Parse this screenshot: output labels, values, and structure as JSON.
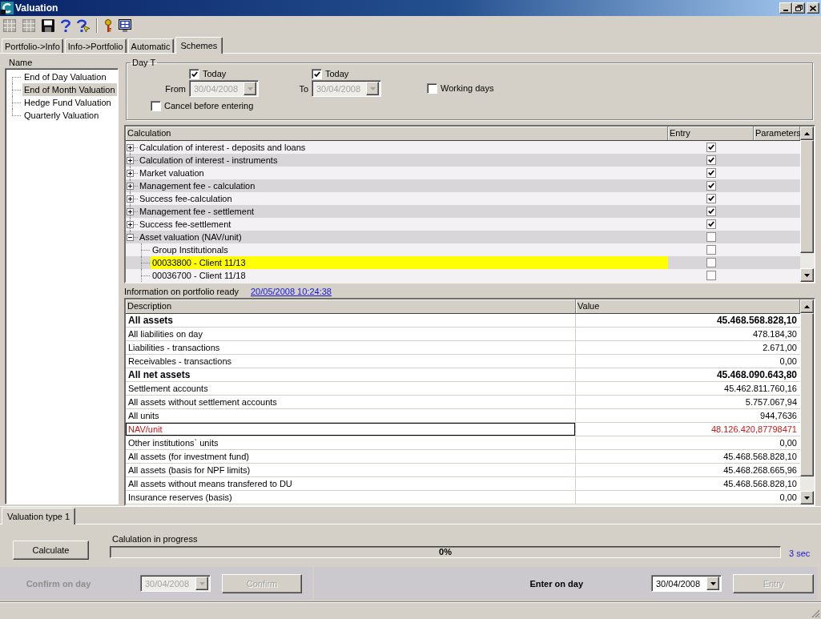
{
  "window": {
    "title": "Valuation"
  },
  "toolbar": [
    {
      "kind": "grid",
      "disabled": true
    },
    {
      "kind": "grid",
      "disabled": true
    },
    {
      "kind": "save",
      "disabled": false
    },
    {
      "kind": "help",
      "disabled": false
    },
    {
      "kind": "help-arrow",
      "disabled": false
    },
    {
      "kind": "separator"
    },
    {
      "kind": "key",
      "disabled": false
    },
    {
      "kind": "monitor",
      "disabled": false
    }
  ],
  "tabs": [
    {
      "label": "Portfolio->Info",
      "selected": false
    },
    {
      "label": "Info->Portfolio",
      "selected": false
    },
    {
      "label": "Automatic",
      "selected": false
    },
    {
      "label": "Schemes",
      "selected": true
    }
  ],
  "schemes": {
    "heading": "Name",
    "items": [
      {
        "label": "End of Day Valuation",
        "selected": false
      },
      {
        "label": "End of Month Valuation",
        "selected": true
      },
      {
        "label": "Hedge Fund Valuation",
        "selected": false
      },
      {
        "label": "Quarterly Valuation",
        "selected": false
      }
    ]
  },
  "day_t": {
    "title": "Day T",
    "from": {
      "today": {
        "label": "Today",
        "checked": true
      },
      "label": "From",
      "date": "30/04/2008",
      "disabled": true
    },
    "to": {
      "today": {
        "label": "Today",
        "checked": true
      },
      "label": "To",
      "date": "30/04/2008",
      "disabled": true
    },
    "working_days": {
      "label": "Working days",
      "checked": false
    },
    "cancel_before_entering": {
      "label": "Cancel before entering",
      "checked": false
    }
  },
  "calculation": {
    "columns": [
      "Calculation",
      "Entry",
      "Parameters"
    ],
    "rows": [
      {
        "label": "Calculation of interest - deposits and loans",
        "expanded": false,
        "entry": true,
        "selected": false
      },
      {
        "label": "Calculation of interest - instruments",
        "expanded": false,
        "entry": true,
        "selected": false
      },
      {
        "label": "Market valuation",
        "expanded": false,
        "entry": true,
        "selected": false
      },
      {
        "label": "Management fee - calculation",
        "expanded": false,
        "entry": true,
        "selected": false
      },
      {
        "label": "Success fee-calculation",
        "expanded": false,
        "entry": true,
        "selected": false
      },
      {
        "label": "Management fee - settlement",
        "expanded": false,
        "entry": true,
        "selected": false
      },
      {
        "label": "Success fee-settlement",
        "expanded": false,
        "entry": true,
        "selected": false
      },
      {
        "label": "Asset valuation (NAV/unit)",
        "expanded": true,
        "entry": false,
        "selected": false,
        "children": [
          {
            "label": "Group Institutionals",
            "entry": false,
            "selected": false
          },
          {
            "label": "00033800 - Client 11/13",
            "entry": false,
            "selected": true
          },
          {
            "label": "00036700 - Client 11/18",
            "entry": false,
            "selected": false
          }
        ]
      }
    ]
  },
  "info": {
    "label": "Information on portfolio ready",
    "timestamp": "20/05/2008 10:24:38"
  },
  "values": {
    "columns": [
      "Description",
      "Value"
    ],
    "rows": [
      {
        "description": "All assets",
        "value": "45.468.568.828,10",
        "kind": "total",
        "selected": false
      },
      {
        "description": "All liabilities on day",
        "value": "478.184,30",
        "kind": "plain",
        "selected": false
      },
      {
        "description": "Liabilities - transactions",
        "value": "2.671,00",
        "kind": "plain",
        "selected": false
      },
      {
        "description": "Receivables - transactions",
        "value": "0,00",
        "kind": "plain",
        "selected": false
      },
      {
        "description": "All net assets",
        "value": "45.468.090.643,80",
        "kind": "total",
        "selected": false
      },
      {
        "description": "Settlement accounts",
        "value": "45.462.811.760,16",
        "kind": "plain",
        "selected": false
      },
      {
        "description": "All assets without settlement accounts",
        "value": "5.757.067,94",
        "kind": "plain",
        "selected": false
      },
      {
        "description": "All units",
        "value": "944,7636",
        "kind": "plain",
        "selected": false
      },
      {
        "description": "NAV/unit",
        "value": "48.126.420,87798471",
        "kind": "alert",
        "selected": true
      },
      {
        "description": "Other institutions` units",
        "value": "0,00",
        "kind": "plain",
        "selected": false
      },
      {
        "description": "All assets (for investment fund)",
        "value": "45.468.568.828,10",
        "kind": "plain",
        "selected": false
      },
      {
        "description": "All assets (basis for NPF limits)",
        "value": "45.468.268.665,96",
        "kind": "plain",
        "selected": false
      },
      {
        "description": "All assets without means transfered to DU",
        "value": "45.468.568.828,10",
        "kind": "plain",
        "selected": false
      },
      {
        "description": "Insurance reserves (basis)",
        "value": "0,00",
        "kind": "plain",
        "selected": false
      }
    ]
  },
  "bottom_tabs": [
    {
      "label": "Valuation type 1",
      "selected": true
    }
  ],
  "calculate": {
    "button": "Calculate",
    "progress_label": "Calulation in progress",
    "percent": "0%",
    "elapsed": "3 sec"
  },
  "confirm": {
    "label": "Confirm on day",
    "date": "30/04/2008",
    "disabled": true,
    "button": {
      "label": "Confirm",
      "disabled": true
    }
  },
  "enter": {
    "label": "Enter on day",
    "date": "30/04/2008",
    "disabled": false,
    "button": {
      "label": "Entry",
      "disabled": true
    }
  }
}
